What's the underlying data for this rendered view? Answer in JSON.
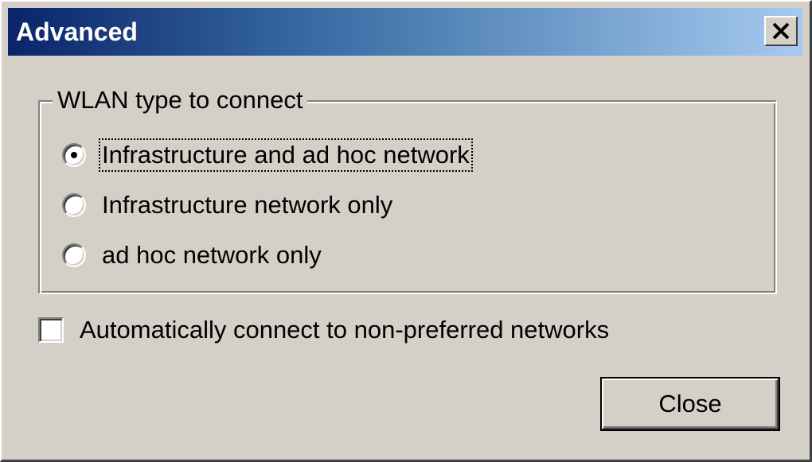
{
  "window": {
    "title": "Advanced",
    "close_icon": "close-icon"
  },
  "group": {
    "legend": "WLAN type to connect",
    "options": [
      {
        "label": "Infrastructure and ad hoc network",
        "checked": true,
        "focused": true
      },
      {
        "label": "Infrastructure  network only",
        "checked": false,
        "focused": false
      },
      {
        "label": "ad hoc network only",
        "checked": false,
        "focused": false
      }
    ]
  },
  "auto_connect": {
    "label": "Automatically connect to non-preferred networks",
    "checked": false
  },
  "buttons": {
    "close_label": "Close"
  },
  "colors": {
    "face": "#d4d0c8",
    "title_start": "#0a246a",
    "title_end": "#a6caf0"
  }
}
